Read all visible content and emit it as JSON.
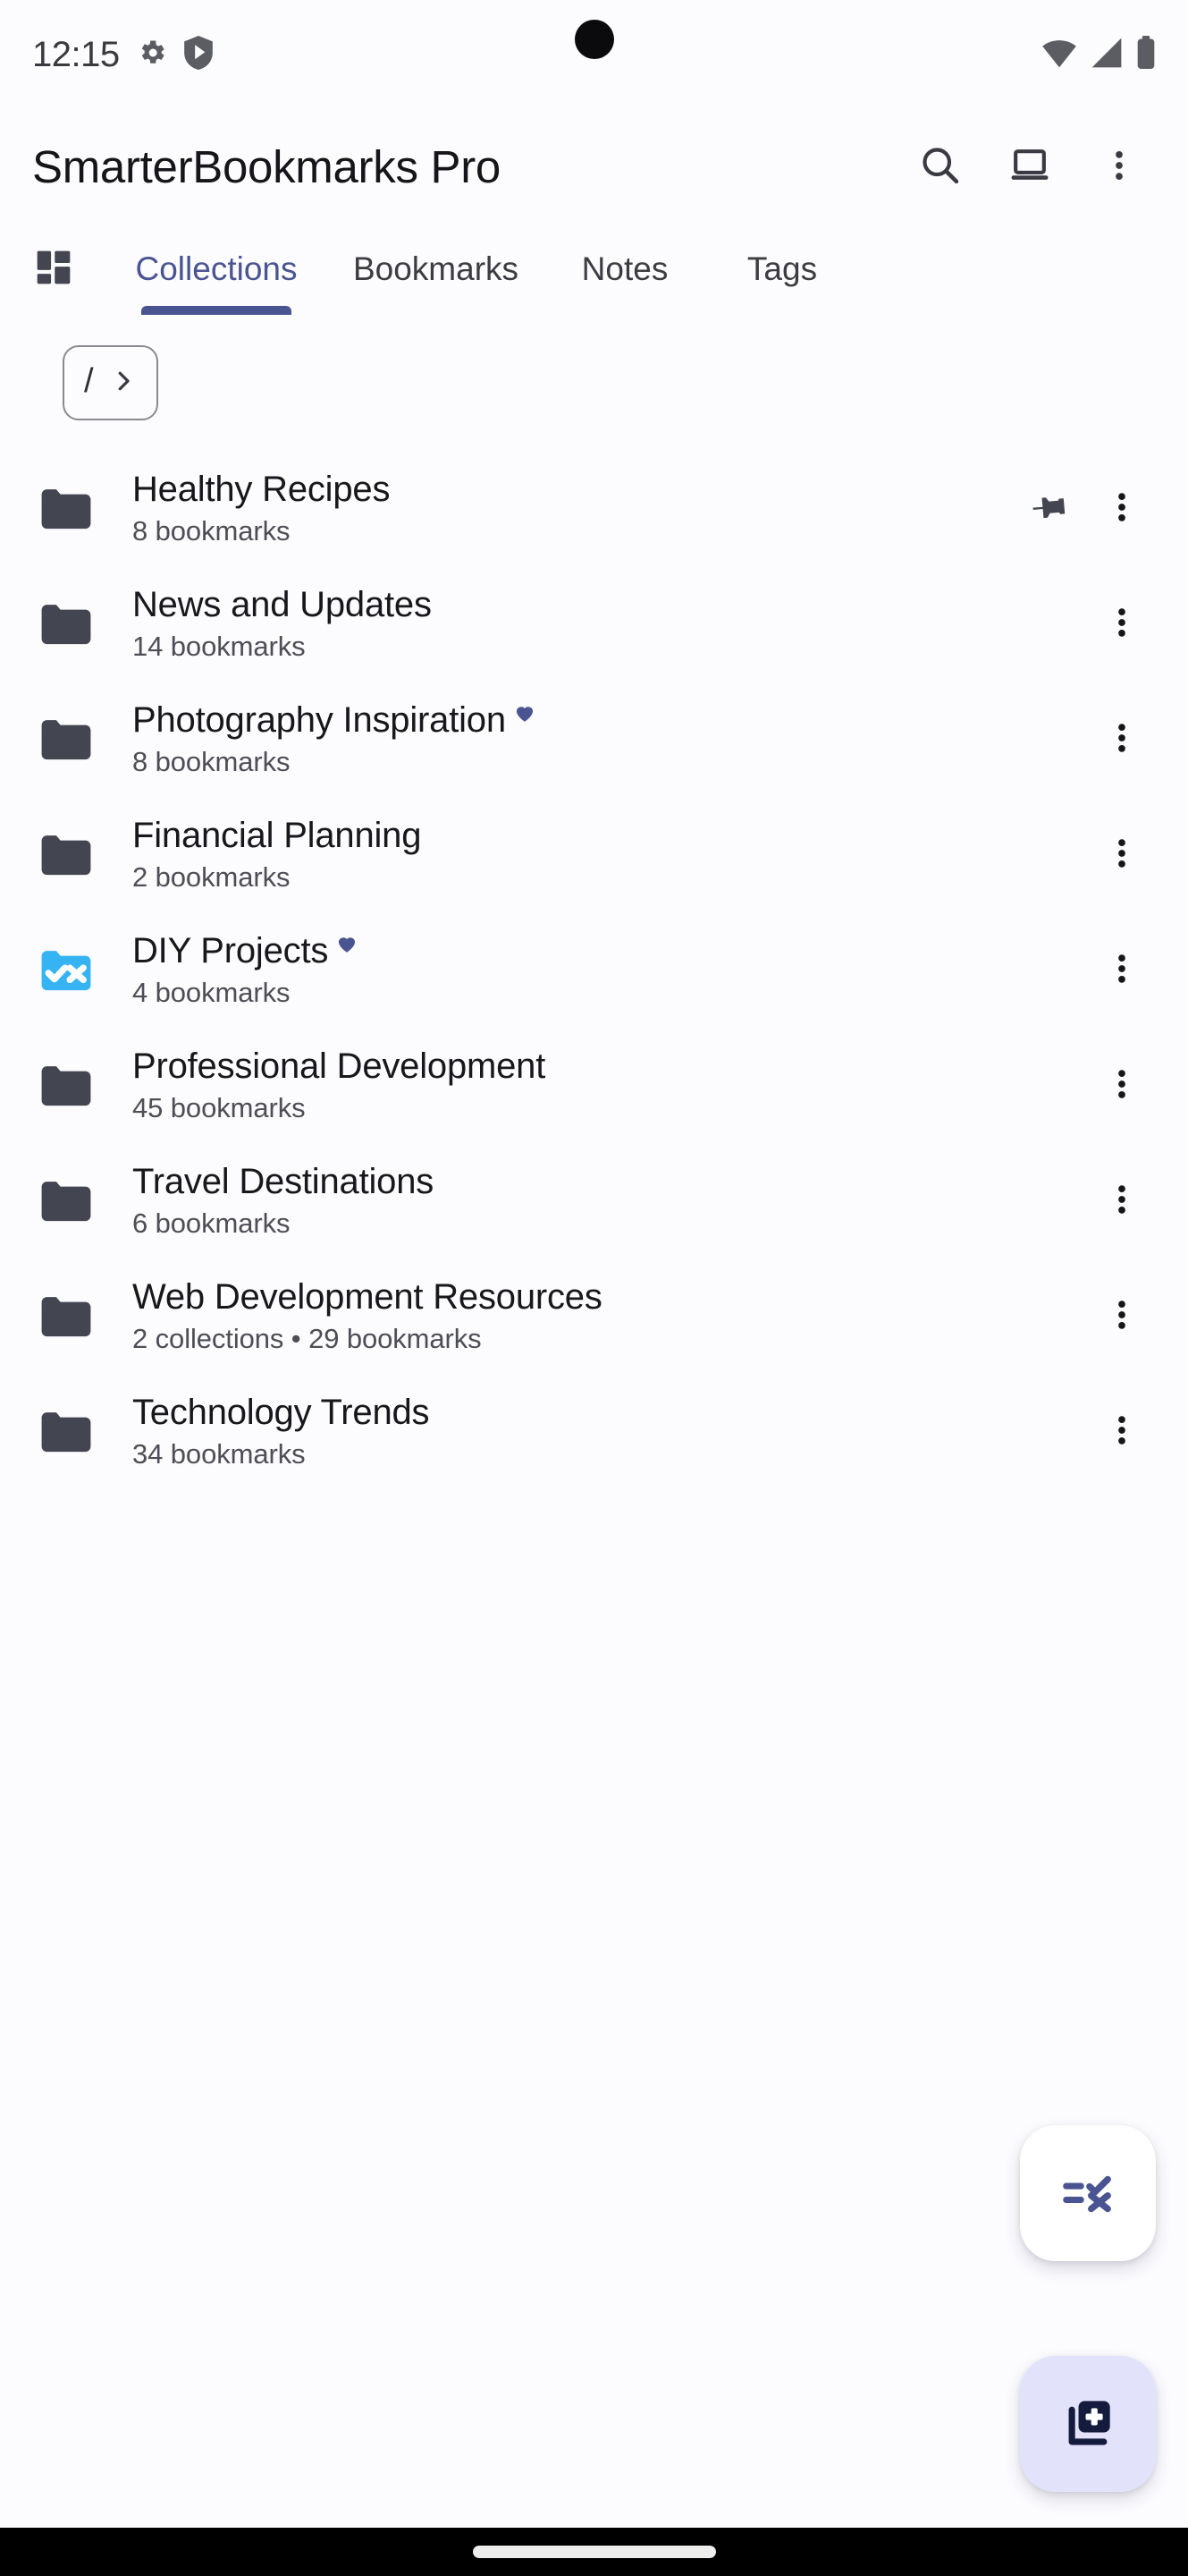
{
  "status_bar": {
    "time": "12:15",
    "left_icons": [
      "gear-icon",
      "play-shield-icon"
    ],
    "right_icons": [
      "wifi-icon",
      "cellular-signal-icon",
      "battery-icon"
    ]
  },
  "app_bar": {
    "title": "SmarterBookmarks Pro",
    "actions": [
      {
        "name": "search-icon",
        "label": "Search"
      },
      {
        "name": "desktop-icon",
        "label": "Desktop view"
      },
      {
        "name": "more-vert-icon",
        "label": "More options"
      }
    ]
  },
  "tabs": {
    "dashboard_icon": "dashboard-icon",
    "items": [
      {
        "label": "Collections",
        "active": true
      },
      {
        "label": "Bookmarks",
        "active": false
      },
      {
        "label": "Notes",
        "active": false
      },
      {
        "label": "Tags",
        "active": false
      }
    ],
    "active_color": "#4A5491"
  },
  "breadcrumb": {
    "root_label": "/",
    "chevron_icon": "chevron-right-icon"
  },
  "collections": [
    {
      "title": "Healthy Recipes",
      "subtitle": "8 bookmarks",
      "folder_style": "plain",
      "favorite": false,
      "pinned": true
    },
    {
      "title": "News and Updates",
      "subtitle": "14 bookmarks",
      "folder_style": "plain",
      "favorite": false,
      "pinned": false
    },
    {
      "title": "Photography Inspiration",
      "subtitle": "8 bookmarks",
      "folder_style": "plain",
      "favorite": true,
      "pinned": false
    },
    {
      "title": "Financial Planning",
      "subtitle": "2 bookmarks",
      "folder_style": "plain",
      "favorite": false,
      "pinned": false
    },
    {
      "title": "DIY Projects",
      "subtitle": "4 bookmarks",
      "folder_style": "check-x",
      "favorite": true,
      "pinned": false
    },
    {
      "title": "Professional Development",
      "subtitle": "45 bookmarks",
      "folder_style": "plain",
      "favorite": false,
      "pinned": false
    },
    {
      "title": "Travel Destinations",
      "subtitle": "6 bookmarks",
      "folder_style": "plain",
      "favorite": false,
      "pinned": false
    },
    {
      "title": "Web Development Resources",
      "subtitle": "2 collections • 29 bookmarks",
      "folder_style": "plain",
      "favorite": false,
      "pinned": false
    },
    {
      "title": "Technology Trends",
      "subtitle": "34 bookmarks",
      "folder_style": "plain",
      "favorite": false,
      "pinned": false
    }
  ],
  "fabs": {
    "select_mode": {
      "icon": "playlist-add-check-icon",
      "background": "#FFFFFF"
    },
    "add_collection": {
      "icon": "library-add-icon",
      "background": "#E2E3FB"
    }
  },
  "colors": {
    "page_background": "#FCFBFE",
    "folder": "#434651",
    "folder_accent": "#35B3F2",
    "accent": "#4A5491",
    "heart": "#4A5491",
    "title_text": "#18181C",
    "subtitle_text": "#4E4E56"
  },
  "row_menu_icon": "more-vert-icon",
  "pin_icon": "push-pin-icon"
}
